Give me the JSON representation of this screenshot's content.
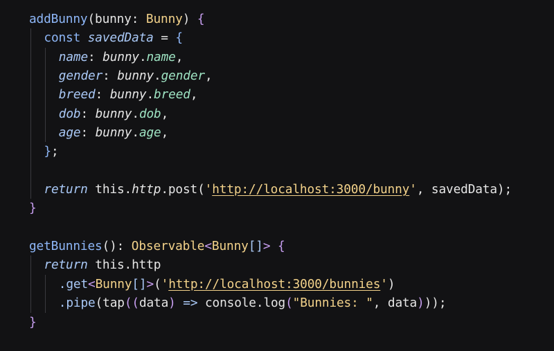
{
  "code": {
    "lines": [
      {
        "indent": 0,
        "tokens": [
          {
            "t": "addBunny",
            "c": "fn"
          },
          {
            "t": "(",
            "c": "par"
          },
          {
            "t": "bunny",
            "c": "pl"
          },
          {
            "t": ": ",
            "c": "punc"
          },
          {
            "t": "Bunny",
            "c": "type"
          },
          {
            "t": ") ",
            "c": "par"
          },
          {
            "t": "{",
            "c": "brace"
          }
        ]
      },
      {
        "indent": 1,
        "tokens": [
          {
            "t": "const ",
            "c": "fn"
          },
          {
            "t": "savedData",
            "c": "prop"
          },
          {
            "t": " = ",
            "c": "punc"
          },
          {
            "t": "{",
            "c": "fn"
          }
        ]
      },
      {
        "indent": 2,
        "tokens": [
          {
            "t": "name",
            "c": "prop"
          },
          {
            "t": ": ",
            "c": "punc"
          },
          {
            "t": "bunny",
            "c": "pl ital"
          },
          {
            "t": ".",
            "c": "punc"
          },
          {
            "t": "name",
            "c": "propv"
          },
          {
            "t": ",",
            "c": "punc"
          }
        ]
      },
      {
        "indent": 2,
        "tokens": [
          {
            "t": "gender",
            "c": "prop"
          },
          {
            "t": ": ",
            "c": "punc"
          },
          {
            "t": "bunny",
            "c": "pl ital"
          },
          {
            "t": ".",
            "c": "punc"
          },
          {
            "t": "gender",
            "c": "propv"
          },
          {
            "t": ",",
            "c": "punc"
          }
        ]
      },
      {
        "indent": 2,
        "tokens": [
          {
            "t": "breed",
            "c": "prop"
          },
          {
            "t": ": ",
            "c": "punc"
          },
          {
            "t": "bunny",
            "c": "pl ital"
          },
          {
            "t": ".",
            "c": "punc"
          },
          {
            "t": "breed",
            "c": "propv"
          },
          {
            "t": ",",
            "c": "punc"
          }
        ]
      },
      {
        "indent": 2,
        "tokens": [
          {
            "t": "dob",
            "c": "prop"
          },
          {
            "t": ": ",
            "c": "punc"
          },
          {
            "t": "bunny",
            "c": "pl ital"
          },
          {
            "t": ".",
            "c": "punc"
          },
          {
            "t": "dob",
            "c": "propv"
          },
          {
            "t": ",",
            "c": "punc"
          }
        ]
      },
      {
        "indent": 2,
        "tokens": [
          {
            "t": "age",
            "c": "prop"
          },
          {
            "t": ": ",
            "c": "punc"
          },
          {
            "t": "bunny",
            "c": "pl ital"
          },
          {
            "t": ".",
            "c": "punc"
          },
          {
            "t": "age",
            "c": "propv"
          },
          {
            "t": ",",
            "c": "punc"
          }
        ]
      },
      {
        "indent": 1,
        "tokens": [
          {
            "t": "}",
            "c": "fn"
          },
          {
            "t": ";",
            "c": "punc"
          }
        ]
      },
      {
        "indent": 1,
        "tokens": []
      },
      {
        "indent": 1,
        "tokens": [
          {
            "t": "return ",
            "c": "prop"
          },
          {
            "t": "this",
            "c": "pl"
          },
          {
            "t": ".",
            "c": "punc"
          },
          {
            "t": "http",
            "c": "pl ital"
          },
          {
            "t": ".",
            "c": "punc"
          },
          {
            "t": "post",
            "c": "pl"
          },
          {
            "t": "(",
            "c": "par"
          },
          {
            "t": "'",
            "c": "str"
          },
          {
            "t": "http://localhost:3000/bunny",
            "c": "url"
          },
          {
            "t": "'",
            "c": "str"
          },
          {
            "t": ", ",
            "c": "punc"
          },
          {
            "t": "savedData",
            "c": "pl"
          },
          {
            "t": ");",
            "c": "par"
          }
        ]
      },
      {
        "indent": 0,
        "tokens": [
          {
            "t": "}",
            "c": "brace"
          }
        ]
      },
      {
        "indent": 0,
        "tokens": []
      },
      {
        "indent": 0,
        "tokens": [
          {
            "t": "getBunnies",
            "c": "fn"
          },
          {
            "t": "(): ",
            "c": "par"
          },
          {
            "t": "Observable",
            "c": "type"
          },
          {
            "t": "<",
            "c": "brace"
          },
          {
            "t": "Bunny",
            "c": "type"
          },
          {
            "t": "[]",
            "c": "arr"
          },
          {
            "t": ">",
            "c": "brace"
          },
          {
            "t": " ",
            "c": "punc"
          },
          {
            "t": "{",
            "c": "brace"
          }
        ]
      },
      {
        "indent": 1,
        "tokens": [
          {
            "t": "return ",
            "c": "prop"
          },
          {
            "t": "this",
            "c": "pl"
          },
          {
            "t": ".",
            "c": "punc"
          },
          {
            "t": "http",
            "c": "pl"
          }
        ]
      },
      {
        "indent": 2,
        "tokens": [
          {
            "t": ".get",
            "c": "arr"
          },
          {
            "t": "<",
            "c": "brace"
          },
          {
            "t": "Bunny",
            "c": "type"
          },
          {
            "t": "[]",
            "c": "arr"
          },
          {
            "t": ">",
            "c": "brace"
          },
          {
            "t": "(",
            "c": "par"
          },
          {
            "t": "'",
            "c": "str"
          },
          {
            "t": "http://localhost:3000/bunnies",
            "c": "url"
          },
          {
            "t": "'",
            "c": "str"
          },
          {
            "t": ")",
            "c": "par"
          }
        ]
      },
      {
        "indent": 2,
        "tokens": [
          {
            "t": ".pipe",
            "c": "arr"
          },
          {
            "t": "(",
            "c": "par"
          },
          {
            "t": "tap",
            "c": "pl"
          },
          {
            "t": "((",
            "c": "brace"
          },
          {
            "t": "data",
            "c": "pl"
          },
          {
            "t": ") ",
            "c": "brace"
          },
          {
            "t": "=>",
            "c": "arr"
          },
          {
            "t": " console",
            "c": "pl"
          },
          {
            "t": ".",
            "c": "punc"
          },
          {
            "t": "log",
            "c": "pl"
          },
          {
            "t": "(",
            "c": "brace"
          },
          {
            "t": "\"Bunnies: \"",
            "c": "str"
          },
          {
            "t": ", data",
            "c": "pl"
          },
          {
            "t": ")",
            "c": "brace"
          },
          {
            "t": "))",
            "c": "par"
          },
          {
            "t": ";",
            "c": "punc"
          }
        ]
      },
      {
        "indent": 0,
        "tokens": [
          {
            "t": "}",
            "c": "brace"
          }
        ]
      }
    ]
  }
}
